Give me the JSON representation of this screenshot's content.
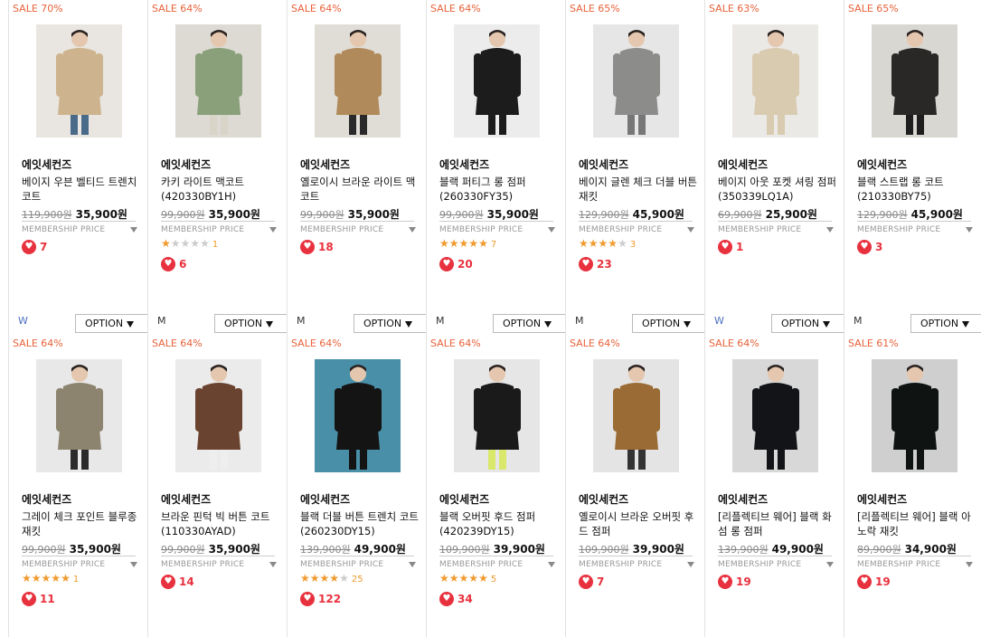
{
  "option_label": "OPTION",
  "member_label": "MEMBERSHIP PRICE",
  "rows": [
    [
      {
        "sale": "SALE 70%",
        "brand": "에잇세컨즈",
        "name": "베이지 우븐 벨티드 트렌치 코트",
        "orig": "119,900원",
        "price": "35,900원",
        "stars": 0,
        "rating": "",
        "likes": "7",
        "size": "W",
        "bg": "#e9e6e1",
        "coat": "#cdb48e",
        "pants": "#4a6a8a"
      },
      {
        "sale": "SALE 64%",
        "brand": "에잇세컨즈",
        "name": "카키 라이트 맥코트(420330BY1H)",
        "orig": "99,900원",
        "price": "35,900원",
        "stars": 1,
        "rating": "1",
        "likes": "6",
        "size": "M",
        "bg": "#dcdad2",
        "coat": "#8aa07a",
        "pants": "#d8d4c8"
      },
      {
        "sale": "SALE 64%",
        "brand": "에잇세컨즈",
        "name": "옐로이시 브라운 라이트 맥코트",
        "orig": "99,900원",
        "price": "35,900원",
        "stars": 0,
        "rating": "",
        "likes": "18",
        "size": "M",
        "bg": "#e0ddd6",
        "coat": "#b08a5a",
        "pants": "#2a2a2a"
      },
      {
        "sale": "SALE 64%",
        "brand": "에잇세컨즈",
        "name": "블랙 퍼티그 롱 점퍼(260330FY35)",
        "orig": "99,900원",
        "price": "35,900원",
        "stars": 4.5,
        "rating": "7",
        "likes": "20",
        "size": "M",
        "bg": "#ececec",
        "coat": "#1c1c1c",
        "pants": "#1c1c1c"
      },
      {
        "sale": "SALE 65%",
        "brand": "에잇세컨즈",
        "name": "베이지 글렌 체크 더블 버튼 재킷",
        "orig": "129,900원",
        "price": "45,900원",
        "stars": 4,
        "rating": "3",
        "likes": "23",
        "size": "M",
        "bg": "#e6e6e6",
        "coat": "#8c8c8a",
        "pants": "#777"
      },
      {
        "sale": "SALE 63%",
        "brand": "에잇세컨즈",
        "name": "베이지 아웃 포켓 셔링 점퍼 (350339LQ1A)",
        "orig": "69,900원",
        "price": "25,900원",
        "stars": 0,
        "rating": "",
        "likes": "1",
        "size": "W",
        "bg": "#ebe9e6",
        "coat": "#d8cbb0",
        "pants": "#d8cbb0"
      },
      {
        "sale": "SALE 65%",
        "brand": "에잇세컨즈",
        "name": "블랙 스트랩 롱 코트(210330BY75)",
        "orig": "129,900원",
        "price": "45,900원",
        "stars": 0,
        "rating": "",
        "likes": "3",
        "size": "M",
        "bg": "#d9d7d2",
        "coat": "#2a2826",
        "pants": "#1e1e1e"
      }
    ],
    [
      {
        "sale": "SALE 64%",
        "brand": "에잇세컨즈",
        "name": "그레이 체크 포인트 블루종 재킷",
        "orig": "99,900원",
        "price": "35,900원",
        "stars": 5,
        "rating": "1",
        "likes": "11",
        "size": "",
        "bg": "#e8e8e8",
        "coat": "#8d8470",
        "pants": "#2b2b2b"
      },
      {
        "sale": "SALE 64%",
        "brand": "에잇세컨즈",
        "name": "브라운 핀턱 빅 버튼 코트 (110330AYAD)",
        "orig": "99,900원",
        "price": "35,900원",
        "stars": 0,
        "rating": "",
        "likes": "14",
        "size": "",
        "bg": "#ebebeb",
        "coat": "#6a4330",
        "pants": "#eee"
      },
      {
        "sale": "SALE 64%",
        "brand": "에잇세컨즈",
        "name": "블랙 더블 버튼 트렌치 코트 (260230DY15)",
        "orig": "139,900원",
        "price": "49,900원",
        "stars": 3.5,
        "rating": "25",
        "likes": "122",
        "size": "",
        "bg": "#4a8fa8",
        "coat": "#141414",
        "pants": "#141414"
      },
      {
        "sale": "SALE 64%",
        "brand": "에잇세컨즈",
        "name": "블랙 오버핏 후드 점퍼 (420239DY15)",
        "orig": "109,900원",
        "price": "39,900원",
        "stars": 5,
        "rating": "5",
        "likes": "34",
        "size": "",
        "bg": "#e6e6e6",
        "coat": "#1a1a1a",
        "pants": "#d9e86a"
      },
      {
        "sale": "SALE 64%",
        "brand": "에잇세컨즈",
        "name": "옐로이시 브라운 오버핏 후드 점퍼",
        "orig": "109,900원",
        "price": "39,900원",
        "stars": 0,
        "rating": "",
        "likes": "7",
        "size": "",
        "bg": "#e4e4e4",
        "coat": "#9a6b34",
        "pants": "#333"
      },
      {
        "sale": "SALE 64%",
        "brand": "에잇세컨즈",
        "name": "[리플렉티브 웨어] 블랙 화섬 롱 점퍼",
        "orig": "139,900원",
        "price": "49,900원",
        "stars": 0,
        "rating": "",
        "likes": "19",
        "size": "",
        "bg": "#d8d8d8",
        "coat": "#121417",
        "pants": "#121417"
      },
      {
        "sale": "SALE 61%",
        "brand": "에잇세컨즈",
        "name": "[리플렉티브 웨어] 블랙 아노락 재킷",
        "orig": "89,900원",
        "price": "34,900원",
        "stars": 0,
        "rating": "",
        "likes": "19",
        "size": "",
        "bg": "#cfcfcf",
        "coat": "#0f1413",
        "pants": "#0f1413"
      }
    ]
  ]
}
